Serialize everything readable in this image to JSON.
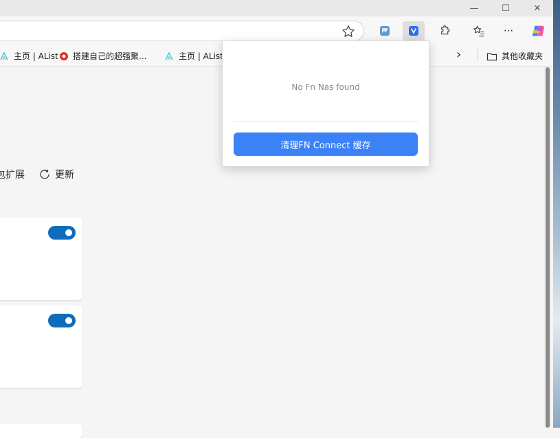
{
  "window": {
    "minimize": "—",
    "maximize": "☐",
    "close": "✕"
  },
  "toolbar": {
    "more": "···"
  },
  "bookmarks": [
    {
      "label": "主页 | AList"
    },
    {
      "label": "搭建自己的超强聚..."
    },
    {
      "label": "主页 | AList"
    }
  ],
  "bookmarks_overflow": "›",
  "other_favorites": "其他收藏夹",
  "page": {
    "actions": [
      "包扩展",
      "更新"
    ]
  },
  "popup": {
    "message": "No Fn Nas found",
    "button": "清理FN Connect 缓存"
  },
  "colors": {
    "accent": "#0f6cbd",
    "popup_button": "#3b82f6"
  }
}
